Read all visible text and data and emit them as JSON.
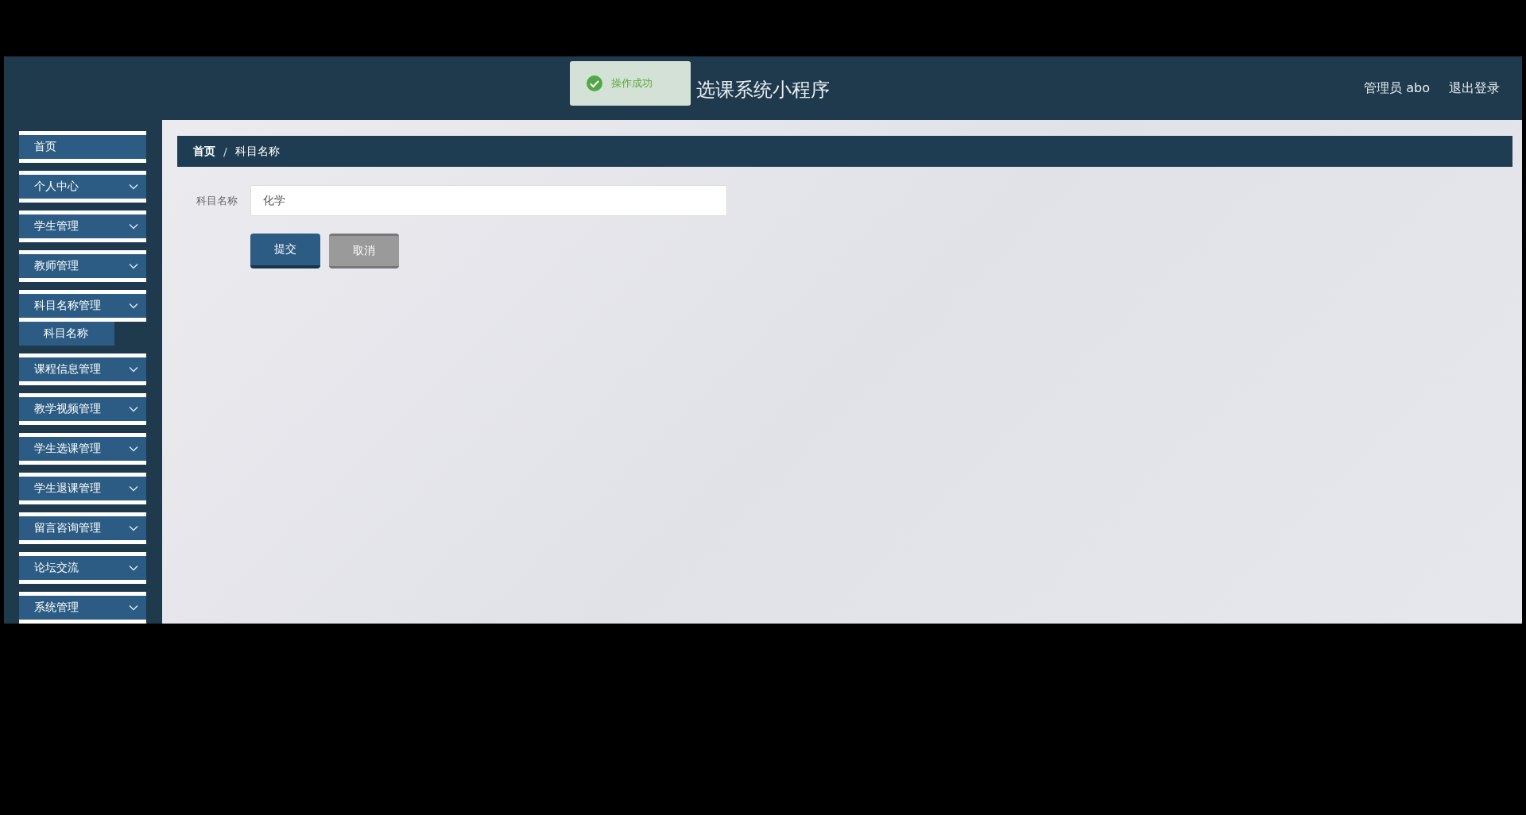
{
  "header": {
    "title": "选课系统小程序",
    "user": "管理员 abo",
    "logout": "退出登录"
  },
  "toast": {
    "text": "操作成功"
  },
  "sidebar": {
    "items": [
      {
        "label": "首页",
        "kind": "link"
      },
      {
        "label": "个人中心",
        "kind": "menu"
      },
      {
        "label": "学生管理",
        "kind": "menu"
      },
      {
        "label": "教师管理",
        "kind": "menu"
      },
      {
        "label": "科目名称管理",
        "kind": "menu",
        "children": [
          {
            "label": "科目名称"
          }
        ]
      },
      {
        "label": "课程信息管理",
        "kind": "menu"
      },
      {
        "label": "教学视频管理",
        "kind": "menu"
      },
      {
        "label": "学生选课管理",
        "kind": "menu"
      },
      {
        "label": "学生退课管理",
        "kind": "menu"
      },
      {
        "label": "留言咨询管理",
        "kind": "menu"
      },
      {
        "label": "论坛交流",
        "kind": "menu"
      },
      {
        "label": "系统管理",
        "kind": "menu"
      }
    ]
  },
  "breadcrumb": {
    "separator": "/",
    "items": [
      "首页",
      "科目名称"
    ]
  },
  "form": {
    "fields": [
      {
        "label": "科目名称",
        "value": "化学"
      }
    ],
    "buttons": [
      {
        "label": "提交",
        "kind": "primary"
      },
      {
        "label": "取消",
        "kind": "secondary"
      }
    ]
  }
}
